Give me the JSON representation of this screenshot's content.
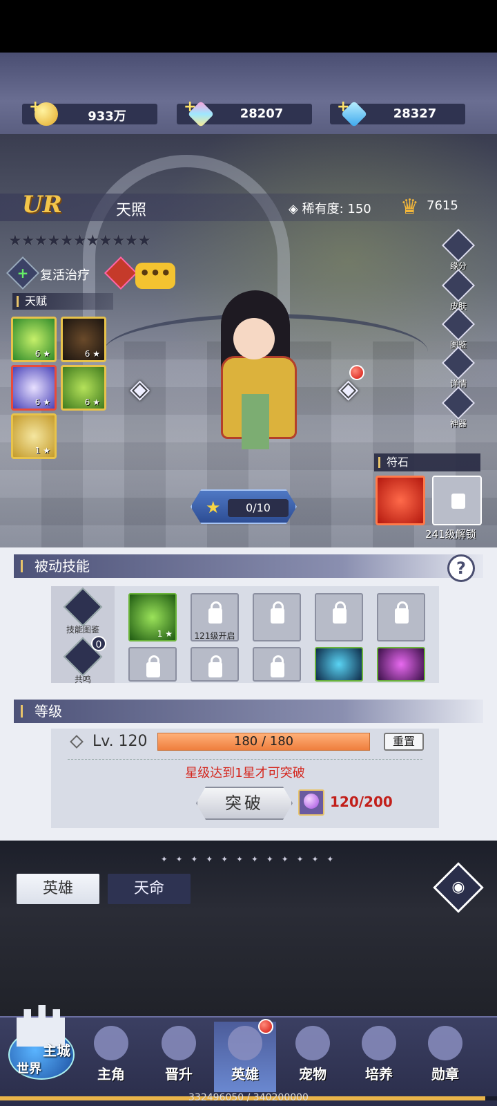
{
  "currency": [
    {
      "icon": "gold-coin-icon",
      "value": "933万"
    },
    {
      "icon": "rainbow-gem-icon",
      "value": "28207"
    },
    {
      "icon": "blue-diamond-icon",
      "value": "28327"
    }
  ],
  "hero": {
    "rarity_tier": "UR",
    "name": "天照",
    "rarity_label": "稀有度: 150",
    "power": "7615",
    "stars": "★★★★★★★★★★★",
    "class_label": "复活治疗",
    "talent_label": "天赋",
    "talents": [
      {
        "level": "6 ★",
        "color": "#5fbf3a"
      },
      {
        "level": "6 ★",
        "color": "#3a2a1a"
      },
      {
        "level": "6 ★",
        "color": "#5a56c4"
      },
      {
        "level": "6 ★",
        "color": "#6ab43a"
      },
      {
        "level": "1 ★",
        "color": "#d8b33c"
      }
    ]
  },
  "side_menu": [
    "缘分",
    "皮肤",
    "图鉴",
    "详情",
    "神器"
  ],
  "rune": {
    "label": "符石",
    "unlock_text": "241级解锁"
  },
  "exp_pill": {
    "value": "0/10"
  },
  "passive": {
    "title": "被动技能",
    "help": "?",
    "side_buttons": [
      "技能图鉴",
      "共鸣"
    ],
    "resonance_count": "0",
    "first_skill_level": "1 ★",
    "unlock_caption": "121级开启"
  },
  "level": {
    "title": "等级",
    "lv_text": "Lv. 120",
    "progress_text": "180 / 180",
    "progress_fraction": 1.0,
    "reset_label": "重置",
    "warning": "星级达到1星才可突破",
    "break_label": "突破",
    "material_count": "120/200"
  },
  "tabs": {
    "active": "英雄",
    "idle": "天命"
  },
  "divider_text": "✦ ✦ ✦ ✦ ✦ ✦ ✦ ✦ ✦ ✦ ✦ ✦",
  "world": {
    "line1": "主城",
    "line2": "世界"
  },
  "nav": [
    "主角",
    "晋升",
    "英雄",
    "宠物",
    "培养",
    "勋章"
  ],
  "player_exp": {
    "text": "332496050 / 340200000",
    "fraction": 0.977
  }
}
